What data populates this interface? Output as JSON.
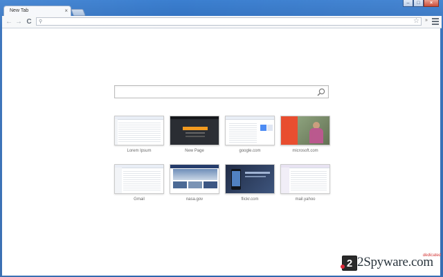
{
  "tabs": [
    {
      "title": "New Tab"
    }
  ],
  "icons": {
    "tab_close": "×",
    "back": "←",
    "forward": "→",
    "reload": "C",
    "star": "☆",
    "extension": "»",
    "omnibox_search": "⚲"
  },
  "window_controls": {
    "minimize": "–",
    "maximize": "□",
    "close": "×"
  },
  "omnibox": {
    "value": "",
    "placeholder": ""
  },
  "search": {
    "value": "",
    "placeholder": ""
  },
  "most_visited": [
    {
      "label": "Lorem Ipsum"
    },
    {
      "label": "New Page"
    },
    {
      "label": "google.com"
    },
    {
      "label": "microsoft.com"
    },
    {
      "label": "Gmail"
    },
    {
      "label": "nasa.gov"
    },
    {
      "label": "flickr.com"
    },
    {
      "label": "mail.yahoo"
    }
  ],
  "watermark": {
    "brand": "2Spyware.com",
    "tag": "dedicated"
  },
  "colors": {
    "frame": "#2f6cb8",
    "content_bg": "#ffffff",
    "thumb_border": "#c9c9c9",
    "label_text": "#666666",
    "microsoft_red": "#e8492a",
    "nasa_navy": "#243b6b",
    "dark_site": "#2a2d33"
  }
}
